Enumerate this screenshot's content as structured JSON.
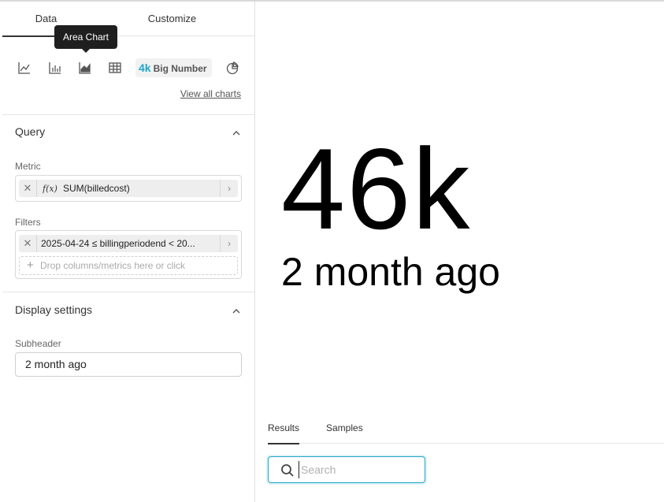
{
  "tabs": {
    "data": "Data",
    "customize": "Customize"
  },
  "tooltip": {
    "text": "Area Chart"
  },
  "chart_types": {
    "items": [
      "line-chart-icon",
      "bar-chart-icon",
      "area-chart-icon",
      "table-icon",
      "big-number-icon",
      "pie-chart-icon"
    ],
    "big_number_prefix": "4k",
    "big_number_label": "Big Number",
    "accent": "#20a7c9"
  },
  "view_all": "View all charts",
  "query": {
    "title": "Query",
    "metric_label": "Metric",
    "metric_fx": "f(x)",
    "metric_value": "SUM(billedcost)",
    "filters_label": "Filters",
    "filter_value": "2025-04-24 ≤ billingperiodend < 20...",
    "drop_placeholder": "Drop columns/metrics here or click"
  },
  "display": {
    "title": "Display settings",
    "subheader_label": "Subheader",
    "subheader_value": "2 month ago"
  },
  "preview": {
    "big_number": "46k",
    "subheader": "2 month ago"
  },
  "results": {
    "tab_results": "Results",
    "tab_samples": "Samples",
    "search_placeholder": "Search"
  }
}
